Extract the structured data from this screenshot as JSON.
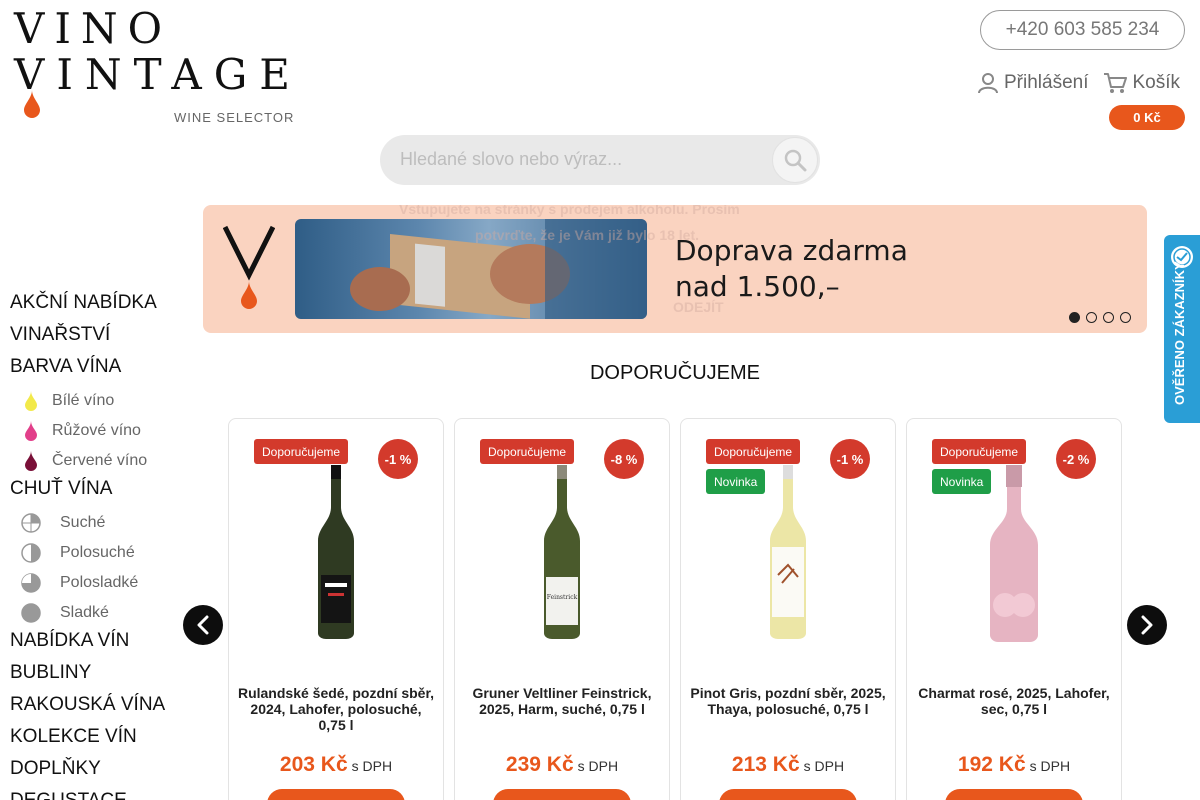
{
  "logo": {
    "line1": "VINO",
    "line2": "VINTAGE",
    "subtitle": "WINE SELECTOR"
  },
  "header": {
    "phone": "+420 603 585 234",
    "login_label": "Přihlášení",
    "cart_label": "Košík",
    "cart_total": "0 Kč"
  },
  "search": {
    "placeholder": "Hledané slovo nebo výraz..."
  },
  "banner": {
    "line1": "Doprava zdarma",
    "line2": "nad 1.500,–",
    "ghost_line1": "Vstupujete na stránky s prodejem alkoholu. Prosím",
    "ghost_line2": "potvrďte, že je Vám již bylo 18 let.",
    "ghost_button": "ODEJÍT",
    "slides": 4,
    "active_slide": 1
  },
  "sidebar": {
    "akce": "AKČNÍ NABÍDKA",
    "vinarstvi": "VINAŘSTVÍ",
    "barva": "BARVA VÍNA",
    "colors": [
      {
        "label": "Bílé víno",
        "color": "#f2e94a"
      },
      {
        "label": "Růžové víno",
        "color": "#e23f8a"
      },
      {
        "label": "Červené víno",
        "color": "#7a1038"
      }
    ],
    "chut": "CHUŤ VÍNA",
    "tastes": [
      {
        "label": "Suché",
        "icon": "dry-icon"
      },
      {
        "label": "Polosuché",
        "icon": "semi-dry-icon"
      },
      {
        "label": "Polosladké",
        "icon": "semi-sweet-icon"
      },
      {
        "label": "Sladké",
        "icon": "sweet-icon"
      }
    ],
    "nabidka": "NABÍDKA VÍN",
    "bubliny": "BUBLINY",
    "rakouska": "RAKOUSKÁ VÍNA",
    "kolekce": "KOLEKCE VÍN",
    "doplnky": "DOPLŇKY",
    "degustace": "DEGUSTACE"
  },
  "verify_badge": "OVĚŘENO ZÁKAZNÍKY",
  "section_title": "DOPORUČUJEME",
  "products": [
    {
      "tag1": "Doporučujeme",
      "tag2": "",
      "discount": "-1 %",
      "name": "Rulandské šedé, pozdní sběr, 2024, Lahofer, polosuché, 0,75 l",
      "price": "203 Kč",
      "vat": "s DPH"
    },
    {
      "tag1": "Doporučujeme",
      "tag2": "",
      "discount": "-8 %",
      "name": "Gruner Veltliner Feinstrick, 2025, Harm, suché, 0,75 l",
      "price": "239 Kč",
      "vat": "s DPH"
    },
    {
      "tag1": "Doporučujeme",
      "tag2": "Novinka",
      "discount": "-1 %",
      "name": "Pinot Gris, pozdní sběr, 2025, Thaya, polosuché, 0,75 l",
      "price": "213 Kč",
      "vat": "s DPH"
    },
    {
      "tag1": "Doporučujeme",
      "tag2": "Novinka",
      "discount": "-2 %",
      "name": "Charmat rosé, 2025, Lahofer, sec, 0,75 l",
      "price": "192 Kč",
      "vat": "s DPH"
    }
  ],
  "colors": {
    "accent": "#e8571c",
    "tag_red": "#d33a2c",
    "tag_green": "#1f9e48",
    "banner_bg": "#fad3c0",
    "verify_blue": "#2a9ed6"
  }
}
